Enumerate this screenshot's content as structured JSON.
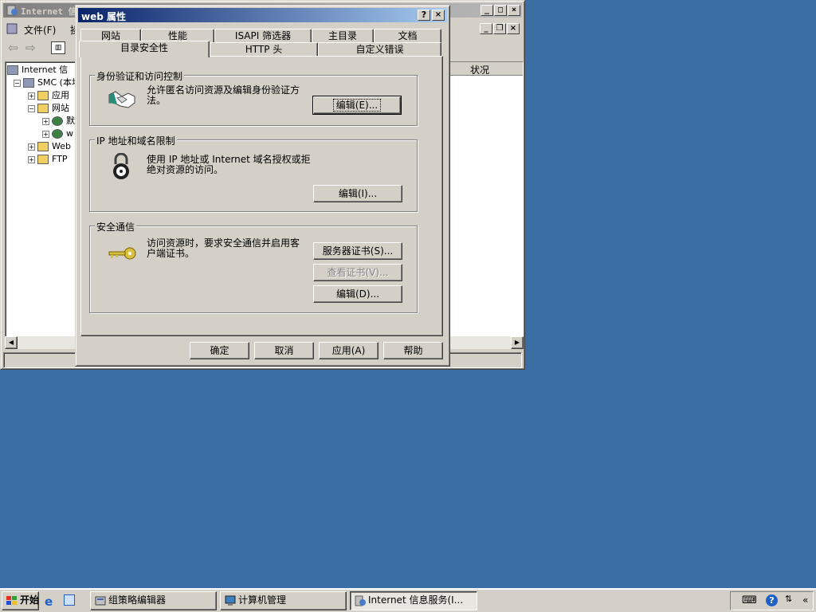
{
  "mmc": {
    "title": "Internet 信",
    "menu": {
      "file": "文件(F)",
      "action": "操"
    },
    "tree": [
      {
        "label": "Internet 信",
        "expander": ""
      },
      {
        "label": "SMC (本地",
        "expander": "−"
      },
      {
        "label": "应用",
        "expander": "+"
      },
      {
        "label": "网站",
        "expander": "−"
      },
      {
        "label": "默",
        "expander": "+"
      },
      {
        "label": "w",
        "expander": "+"
      },
      {
        "label": "Web",
        "expander": "+"
      },
      {
        "label": "FTP",
        "expander": "+"
      }
    ],
    "list_header": "状况"
  },
  "dialog": {
    "title": "web 属性",
    "tabs_back": [
      "网站",
      "性能",
      "ISAPI 筛选器",
      "主目录",
      "文档"
    ],
    "tabs_front": [
      "目录安全性",
      "HTTP 头",
      "自定义错误"
    ],
    "active_tab": "目录安全性",
    "groups": {
      "auth": {
        "legend": "身份验证和访问控制",
        "text": "允许匿名访问资源及编辑身份验证方法。",
        "edit_button": "编辑(E)..."
      },
      "ip": {
        "legend": "IP 地址和域名限制",
        "text": "使用 IP 地址或 Internet 域名授权或拒绝对资源的访问。",
        "edit_button": "编辑(I)..."
      },
      "secure": {
        "legend": "安全通信",
        "text": "访问资源时，要求安全通信并启用客户端证书。",
        "server_cert_button": "服务器证书(S)...",
        "view_cert_button": "查看证书(V)...",
        "edit_button": "编辑(D)..."
      }
    },
    "buttons": {
      "ok": "确定",
      "cancel": "取消",
      "apply": "应用(A)",
      "help": "帮助"
    }
  },
  "taskbar": {
    "start": "开始",
    "tasks": [
      "组策略编辑器",
      "计算机管理",
      "Internet 信息服务(I..."
    ],
    "active_task": "Internet 信息服务(I..."
  },
  "colors": {
    "desktop": "#3a6ea5",
    "title_active": "#0a246a",
    "face": "#d4d0c8"
  }
}
